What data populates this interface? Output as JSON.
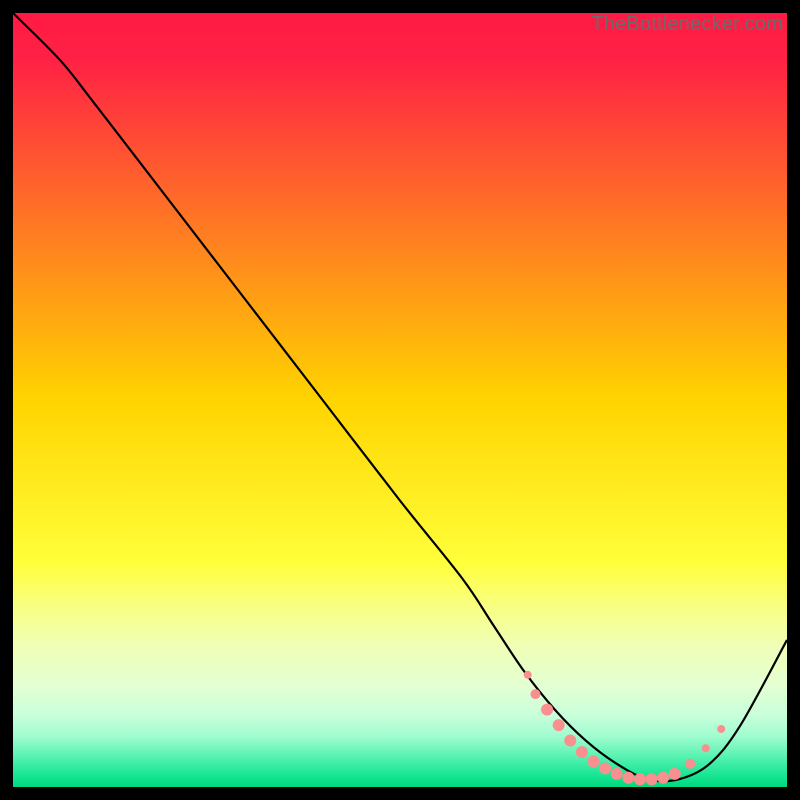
{
  "watermark": {
    "text": "TheBottlenecker.com"
  },
  "colors": {
    "gradient_stops": [
      {
        "offset": 0.0,
        "color": "#ff1a44"
      },
      {
        "offset": 0.06,
        "color": "#ff2145"
      },
      {
        "offset": 0.5,
        "color": "#ffd400"
      },
      {
        "offset": 0.71,
        "color": "#ffff3a"
      },
      {
        "offset": 0.77,
        "color": "#f8ff86"
      },
      {
        "offset": 0.82,
        "color": "#efffb8"
      },
      {
        "offset": 0.87,
        "color": "#e3ffd2"
      },
      {
        "offset": 0.908,
        "color": "#c7ffda"
      },
      {
        "offset": 0.935,
        "color": "#9ffccf"
      },
      {
        "offset": 0.96,
        "color": "#59f2b2"
      },
      {
        "offset": 0.985,
        "color": "#17e593"
      },
      {
        "offset": 1.0,
        "color": "#00d97f"
      }
    ],
    "curve": "#000000",
    "dot_fill": "#fa8f8f",
    "dot_stroke": "#d86a6a"
  },
  "chart_data": {
    "type": "line",
    "title": "",
    "xlabel": "",
    "ylabel": "",
    "xlim": [
      0,
      100
    ],
    "ylim": [
      0,
      100
    ],
    "series": [
      {
        "name": "bottleneck-curve",
        "x": [
          0,
          6,
          10,
          20,
          30,
          40,
          50,
          58,
          62,
          66,
          70,
          74,
          78,
          82,
          86,
          90,
          94,
          100
        ],
        "y": [
          100,
          94,
          89,
          76,
          63,
          50,
          37,
          27,
          21,
          15,
          10,
          6,
          3,
          1,
          1,
          3,
          8,
          19
        ]
      }
    ],
    "markers": [
      {
        "x": 66.5,
        "y": 14.5,
        "r": 4
      },
      {
        "x": 67.5,
        "y": 12.0,
        "r": 5
      },
      {
        "x": 69.0,
        "y": 10.0,
        "r": 6
      },
      {
        "x": 70.5,
        "y": 8.0,
        "r": 6
      },
      {
        "x": 72.0,
        "y": 6.0,
        "r": 6
      },
      {
        "x": 73.5,
        "y": 4.5,
        "r": 6
      },
      {
        "x": 75.0,
        "y": 3.3,
        "r": 6
      },
      {
        "x": 76.5,
        "y": 2.4,
        "r": 6
      },
      {
        "x": 78.0,
        "y": 1.7,
        "r": 6
      },
      {
        "x": 79.5,
        "y": 1.2,
        "r": 6
      },
      {
        "x": 81.0,
        "y": 1.0,
        "r": 6
      },
      {
        "x": 82.5,
        "y": 1.0,
        "r": 6
      },
      {
        "x": 84.0,
        "y": 1.2,
        "r": 6
      },
      {
        "x": 85.5,
        "y": 1.7,
        "r": 6
      },
      {
        "x": 87.5,
        "y": 3.0,
        "r": 5
      },
      {
        "x": 89.5,
        "y": 5.0,
        "r": 4
      },
      {
        "x": 91.5,
        "y": 7.5,
        "r": 4
      }
    ]
  }
}
